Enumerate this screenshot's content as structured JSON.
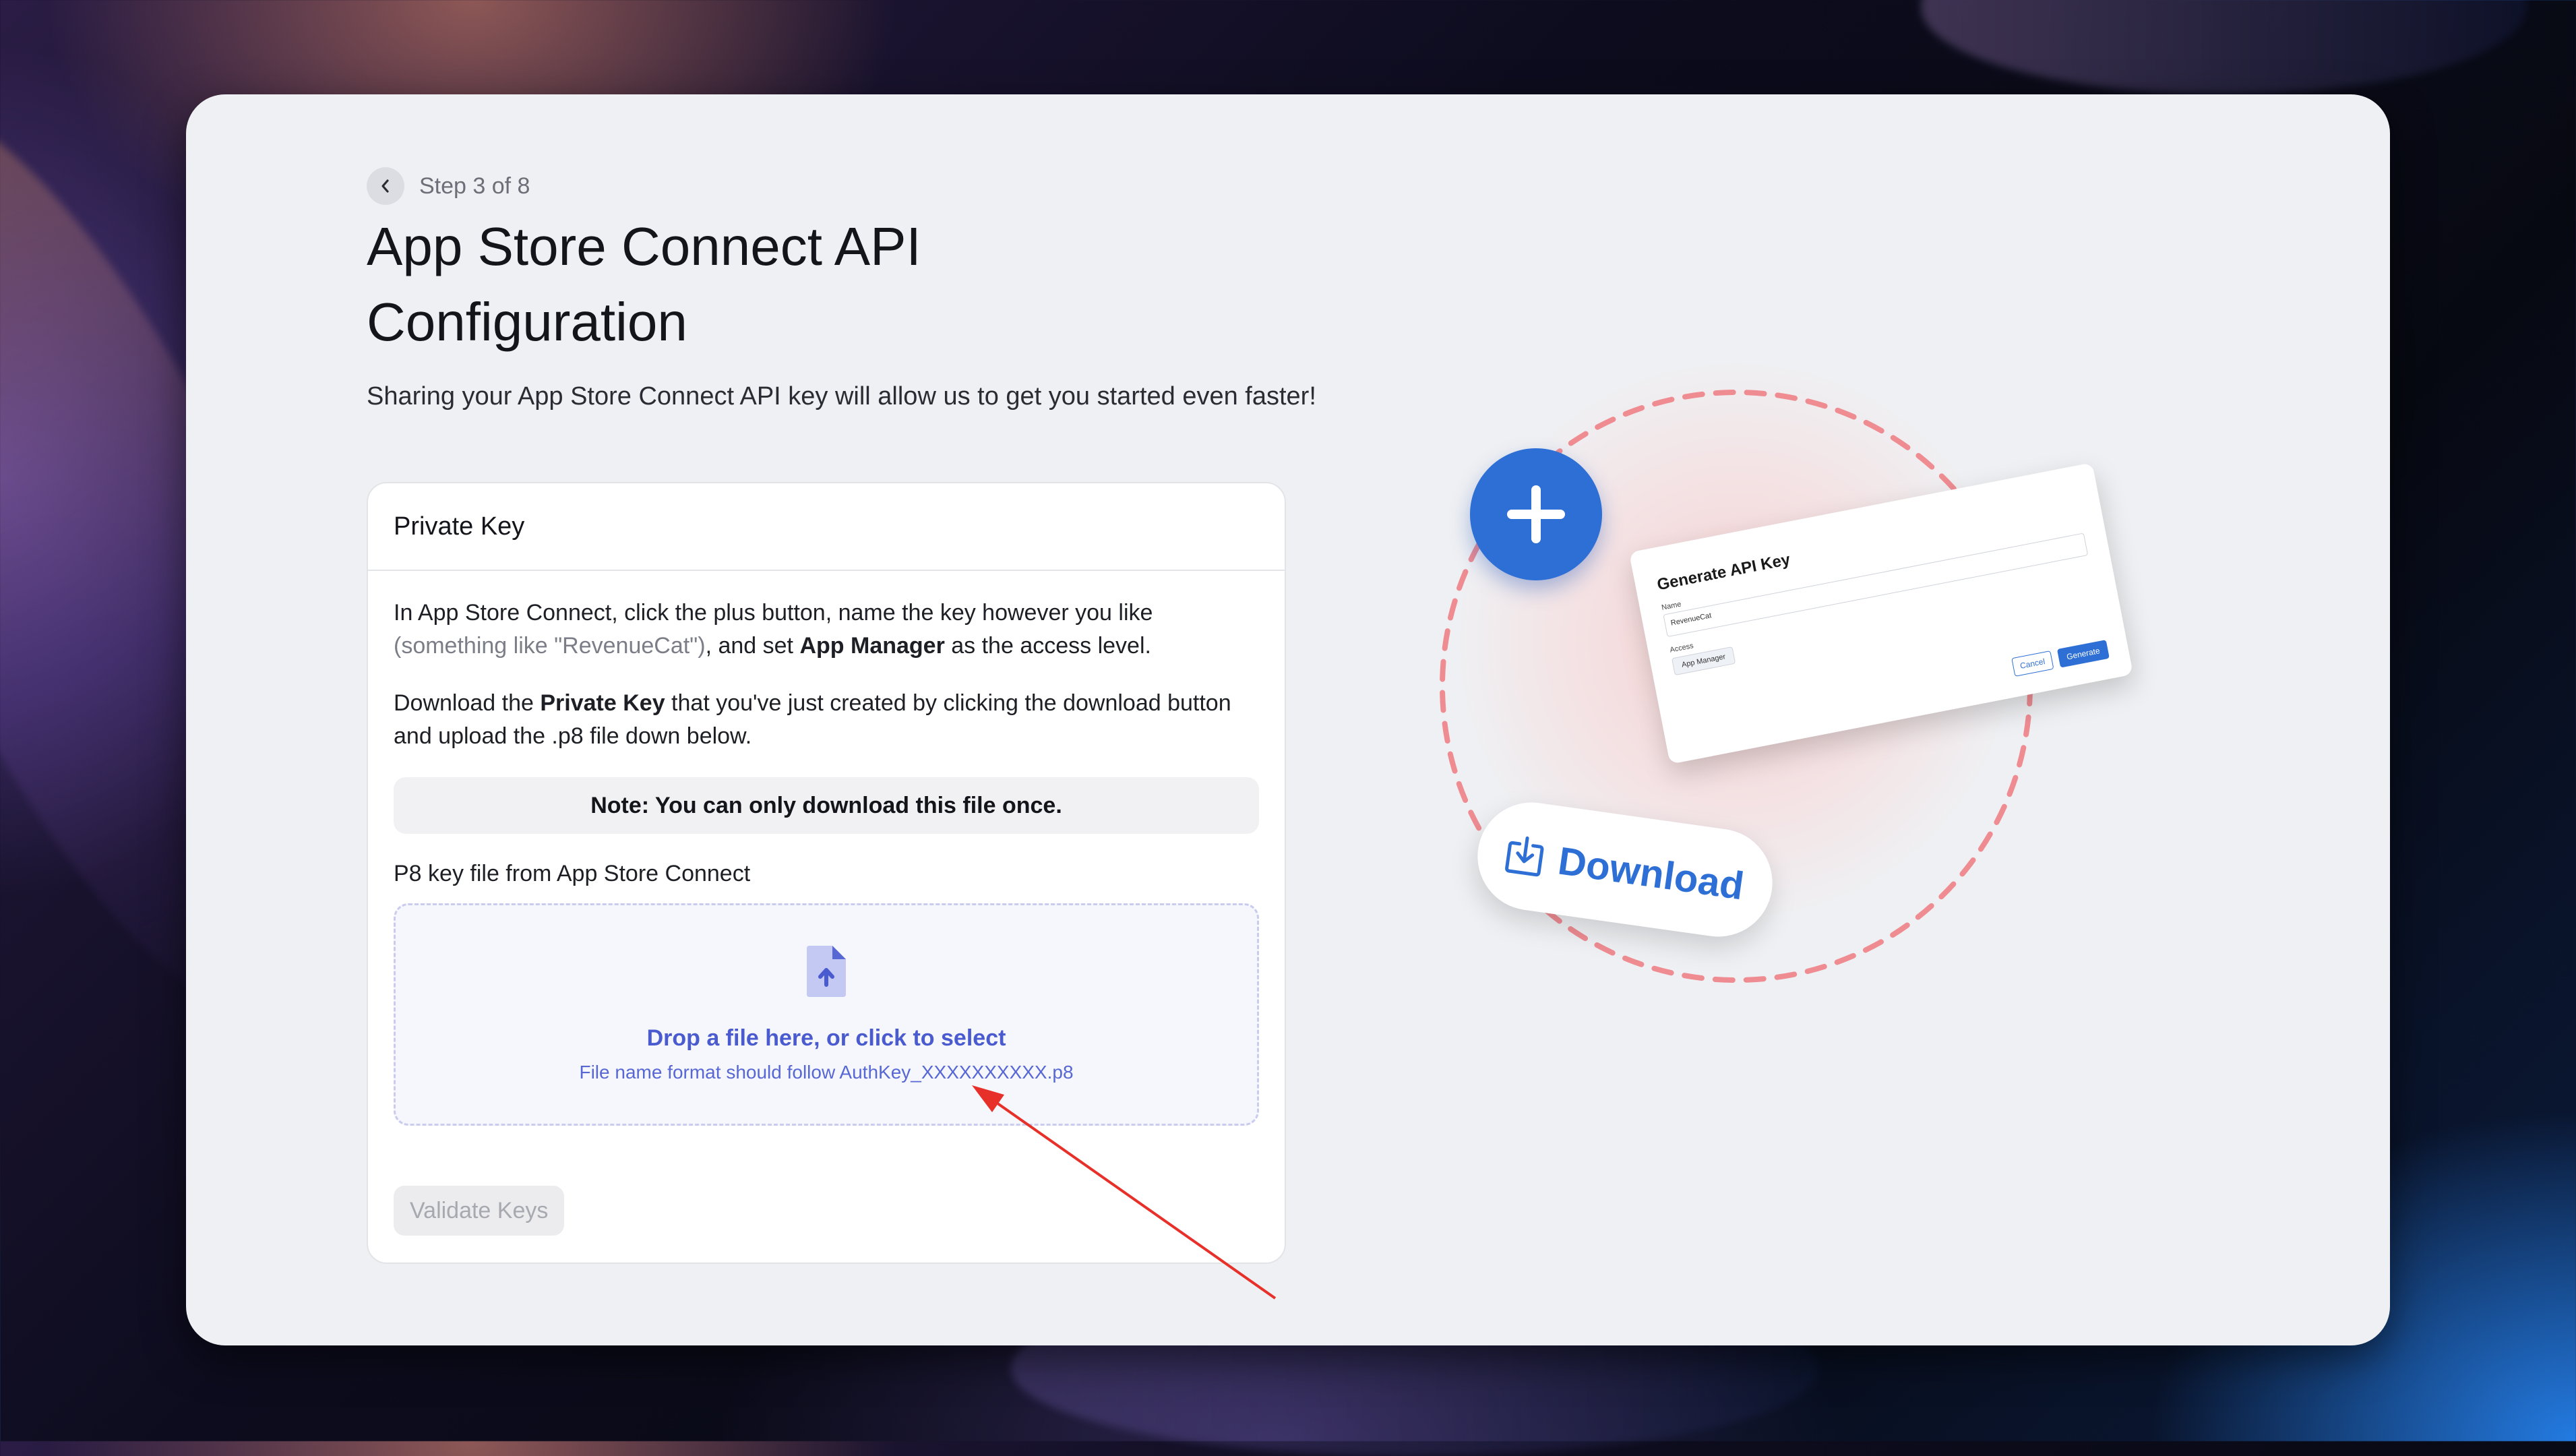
{
  "step": {
    "text": "Step 3 of 8"
  },
  "header": {
    "title": "App Store Connect API Configuration",
    "subtitle": "Sharing your App Store Connect API key will allow us to get you started even faster!"
  },
  "panel": {
    "title": "Private Key",
    "para1": {
      "text_a": "In App Store Connect, click the plus button, name the key however you like ",
      "muted": "(something like \"RevenueCat\")",
      "text_b": ", and set ",
      "bold": "App Manager",
      "text_c": " as the access level."
    },
    "para2": {
      "text_a": "Download the ",
      "bold": "Private Key",
      "text_b": " that you've just created by clicking the download button and upload the .p8 file down below."
    },
    "note": "Note: You can only download this file once.",
    "field_label": "P8 key file from App Store Connect",
    "dropzone": {
      "main": "Drop a file here, or click to select",
      "hint": "File name format should follow AuthKey_XXXXXXXXXX.p8"
    },
    "validate_label": "Validate Keys"
  },
  "illustration": {
    "mini_card": {
      "title": "Generate API Key",
      "name_label": "Name",
      "name_value": "RevenueCat",
      "access_label": "Access",
      "access_value": "App Manager",
      "cancel": "Cancel",
      "generate": "Generate"
    },
    "download_label": "Download"
  },
  "colors": {
    "accent": "#2e6fd6",
    "dropzone_text": "#4a5bd0",
    "annotation_arrow": "#e8302a",
    "dashed_circle": "#ee8c92"
  }
}
